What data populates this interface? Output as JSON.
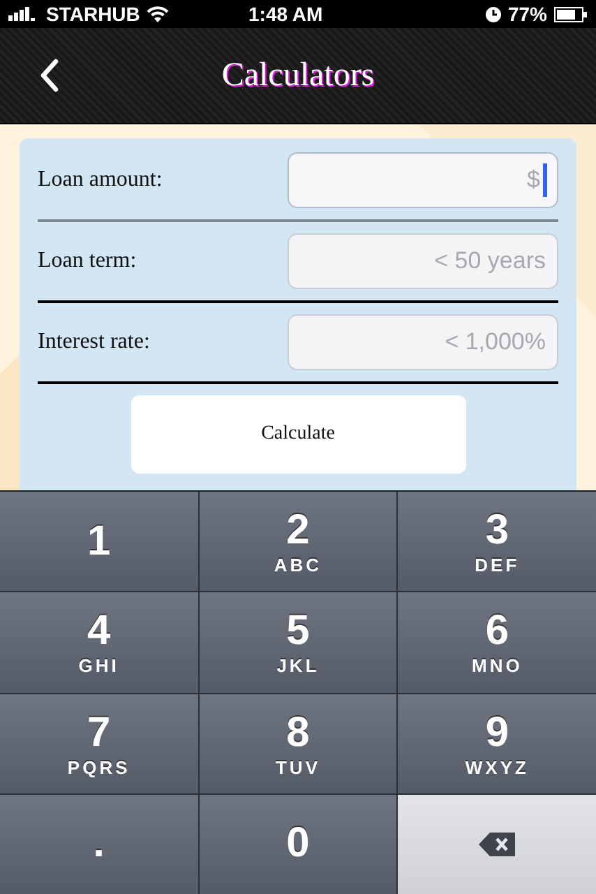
{
  "status_bar": {
    "carrier": "STARHUB",
    "time": "1:48 AM",
    "battery": "77%"
  },
  "nav_bar": {
    "title": "Calculators"
  },
  "form": {
    "fields": [
      {
        "label": "Loan amount:",
        "placeholder": "$",
        "focused": true
      },
      {
        "label": "Loan term:",
        "placeholder": "< 50 years",
        "focused": false
      },
      {
        "label": "Interest rate:",
        "placeholder": "< 1,000%",
        "focused": false
      }
    ],
    "button": "Calculate"
  },
  "keyboard": {
    "keys": [
      {
        "kind": "digit",
        "label": "1"
      },
      {
        "kind": "digit",
        "label": "2",
        "letters": "ABC"
      },
      {
        "kind": "digit",
        "label": "3",
        "letters": "DEF"
      },
      {
        "kind": "digit",
        "label": "4",
        "letters": "GHI"
      },
      {
        "kind": "digit",
        "label": "5",
        "letters": "JKL"
      },
      {
        "kind": "digit",
        "label": "6",
        "letters": "MNO"
      },
      {
        "kind": "digit",
        "label": "7",
        "letters": "PQRS"
      },
      {
        "kind": "digit",
        "label": "8",
        "letters": "TUV"
      },
      {
        "kind": "digit",
        "label": "9",
        "letters": "WXYZ"
      },
      {
        "kind": "digit",
        "label": "."
      },
      {
        "kind": "digit",
        "label": "0"
      },
      {
        "kind": "backspace"
      }
    ]
  }
}
